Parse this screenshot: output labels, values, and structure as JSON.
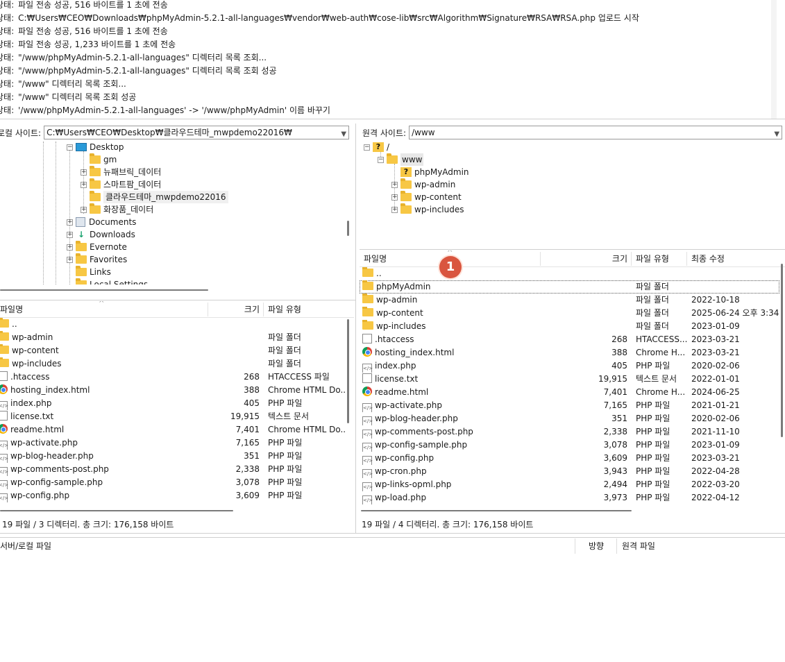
{
  "log": [
    {
      "label": "상태:",
      "text": "파일 전송 성공, 516 바이트를 1 초에 전송"
    },
    {
      "label": "상태:",
      "text": "C:₩Users₩CEO₩Downloads₩phpMyAdmin-5.2.1-all-languages₩vendor₩web-auth₩cose-lib₩src₩Algorithm₩Signature₩RSA₩RSA.php 업로드 시작"
    },
    {
      "label": "상태:",
      "text": "파일 전송 성공, 516 바이트를 1 초에 전송"
    },
    {
      "label": "상태:",
      "text": "파일 전송 성공, 1,233 바이트를 1 초에 전송"
    },
    {
      "label": "상태:",
      "text": "\"/www/phpMyAdmin-5.2.1-all-languages\" 디렉터리 목록 조회..."
    },
    {
      "label": "상태:",
      "text": "\"/www/phpMyAdmin-5.2.1-all-languages\" 디렉터리 목록 조회 성공"
    },
    {
      "label": "상태:",
      "text": "\"/www\" 디렉터리 목록 조회..."
    },
    {
      "label": "상태:",
      "text": "\"/www\" 디렉터리 목록 조회 성공"
    },
    {
      "label": "상태:",
      "text": "'/www/phpMyAdmin-5.2.1-all-languages' -> '/www/phpMyAdmin' 이름 바꾸기"
    }
  ],
  "local_site": {
    "label": "로컬 사이트:",
    "path": "C:₩Users₩CEO₩Desktop₩클라우드테마_mwpdemo22016₩"
  },
  "remote_site": {
    "label": "원격 사이트:",
    "path": "/www"
  },
  "local_tree": [
    {
      "label": "Desktop",
      "icon": "desktop-icon"
    },
    {
      "label": "gm",
      "icon": "folder-icon"
    },
    {
      "label": "뉴패브릭_데이터",
      "icon": "folder-icon"
    },
    {
      "label": "스마트팜_데이터",
      "icon": "folder-icon"
    },
    {
      "label": "클라우드테마_mwpdemo22016",
      "icon": "folder-icon"
    },
    {
      "label": "화장품_데이터",
      "icon": "folder-icon"
    },
    {
      "label": "Documents",
      "icon": "documents-icon"
    },
    {
      "label": "Downloads",
      "icon": "download-icon"
    },
    {
      "label": "Evernote",
      "icon": "folder-icon"
    },
    {
      "label": "Favorites",
      "icon": "folder-icon"
    },
    {
      "label": "Links",
      "icon": "folder-icon"
    },
    {
      "label": "Local Settings",
      "icon": "folder-icon"
    }
  ],
  "remote_tree": [
    {
      "label": "/",
      "icon": "unknown-folder-icon"
    },
    {
      "label": "www",
      "icon": "folder-icon"
    },
    {
      "label": "phpMyAdmin",
      "icon": "unknown-folder-icon"
    },
    {
      "label": "wp-admin",
      "icon": "folder-icon"
    },
    {
      "label": "wp-content",
      "icon": "folder-icon"
    },
    {
      "label": "wp-includes",
      "icon": "folder-icon"
    }
  ],
  "local_list": {
    "headers": {
      "name": "파일명",
      "size": "크기",
      "type": "파일 유형"
    },
    "rows": [
      {
        "name": "..",
        "size": "",
        "type": "",
        "icon": "folder"
      },
      {
        "name": "wp-admin",
        "size": "",
        "type": "파일 폴더",
        "icon": "folder"
      },
      {
        "name": "wp-content",
        "size": "",
        "type": "파일 폴더",
        "icon": "folder"
      },
      {
        "name": "wp-includes",
        "size": "",
        "type": "파일 폴더",
        "icon": "folder"
      },
      {
        "name": ".htaccess",
        "size": "268",
        "type": "HTACCESS 파일",
        "icon": "doc"
      },
      {
        "name": "hosting_index.html",
        "size": "388",
        "type": "Chrome HTML Do...",
        "icon": "chrome"
      },
      {
        "name": "index.php",
        "size": "405",
        "type": "PHP 파일",
        "icon": "php"
      },
      {
        "name": "license.txt",
        "size": "19,915",
        "type": "텍스트 문서",
        "icon": "doc"
      },
      {
        "name": "readme.html",
        "size": "7,401",
        "type": "Chrome HTML Do...",
        "icon": "chrome"
      },
      {
        "name": "wp-activate.php",
        "size": "7,165",
        "type": "PHP 파일",
        "icon": "php"
      },
      {
        "name": "wp-blog-header.php",
        "size": "351",
        "type": "PHP 파일",
        "icon": "php"
      },
      {
        "name": "wp-comments-post.php",
        "size": "2,338",
        "type": "PHP 파일",
        "icon": "php"
      },
      {
        "name": "wp-config-sample.php",
        "size": "3,078",
        "type": "PHP 파일",
        "icon": "php"
      },
      {
        "name": "wp-config.php",
        "size": "3,609",
        "type": "PHP 파일",
        "icon": "php"
      }
    ]
  },
  "remote_list": {
    "headers": {
      "name": "파일명",
      "size": "크기",
      "type": "파일 유형",
      "modified": "최종 수정"
    },
    "rows": [
      {
        "name": "..",
        "size": "",
        "type": "",
        "modified": "",
        "icon": "folder"
      },
      {
        "name": "phpMyAdmin",
        "size": "",
        "type": "파일 폴더",
        "modified": "",
        "icon": "folder"
      },
      {
        "name": "wp-admin",
        "size": "",
        "type": "파일 폴더",
        "modified": "2022-10-18",
        "icon": "folder"
      },
      {
        "name": "wp-content",
        "size": "",
        "type": "파일 폴더",
        "modified": "2025-06-24 오후 3:34",
        "icon": "folder"
      },
      {
        "name": "wp-includes",
        "size": "",
        "type": "파일 폴더",
        "modified": "2023-01-09",
        "icon": "folder"
      },
      {
        "name": ".htaccess",
        "size": "268",
        "type": "HTACCESS...",
        "modified": "2023-03-21",
        "icon": "doc"
      },
      {
        "name": "hosting_index.html",
        "size": "388",
        "type": "Chrome H...",
        "modified": "2023-03-21",
        "icon": "chrome"
      },
      {
        "name": "index.php",
        "size": "405",
        "type": "PHP 파일",
        "modified": "2020-02-06",
        "icon": "php"
      },
      {
        "name": "license.txt",
        "size": "19,915",
        "type": "텍스트 문서",
        "modified": "2022-01-01",
        "icon": "doc"
      },
      {
        "name": "readme.html",
        "size": "7,401",
        "type": "Chrome H...",
        "modified": "2024-06-25",
        "icon": "chrome"
      },
      {
        "name": "wp-activate.php",
        "size": "7,165",
        "type": "PHP 파일",
        "modified": "2021-01-21",
        "icon": "php"
      },
      {
        "name": "wp-blog-header.php",
        "size": "351",
        "type": "PHP 파일",
        "modified": "2020-02-06",
        "icon": "php"
      },
      {
        "name": "wp-comments-post.php",
        "size": "2,338",
        "type": "PHP 파일",
        "modified": "2021-11-10",
        "icon": "php"
      },
      {
        "name": "wp-config-sample.php",
        "size": "3,078",
        "type": "PHP 파일",
        "modified": "2023-01-09",
        "icon": "php"
      },
      {
        "name": "wp-config.php",
        "size": "3,609",
        "type": "PHP 파일",
        "modified": "2023-03-21",
        "icon": "php"
      },
      {
        "name": "wp-cron.php",
        "size": "3,943",
        "type": "PHP 파일",
        "modified": "2022-04-28",
        "icon": "php"
      },
      {
        "name": "wp-links-opml.php",
        "size": "2,494",
        "type": "PHP 파일",
        "modified": "2022-03-20",
        "icon": "php"
      },
      {
        "name": "wp-load.php",
        "size": "3,973",
        "type": "PHP 파일",
        "modified": "2022-04-12",
        "icon": "php"
      }
    ]
  },
  "local_status": "19 파일 / 3 디렉터리. 총 크기: 176,158 바이트",
  "remote_status": "19 파일 / 4 디렉터리. 총 크기: 176,158 바이트",
  "badge": "1",
  "queue": {
    "file": "서버/로컬 파일",
    "direction": "방향",
    "remote": "원격 파일"
  }
}
